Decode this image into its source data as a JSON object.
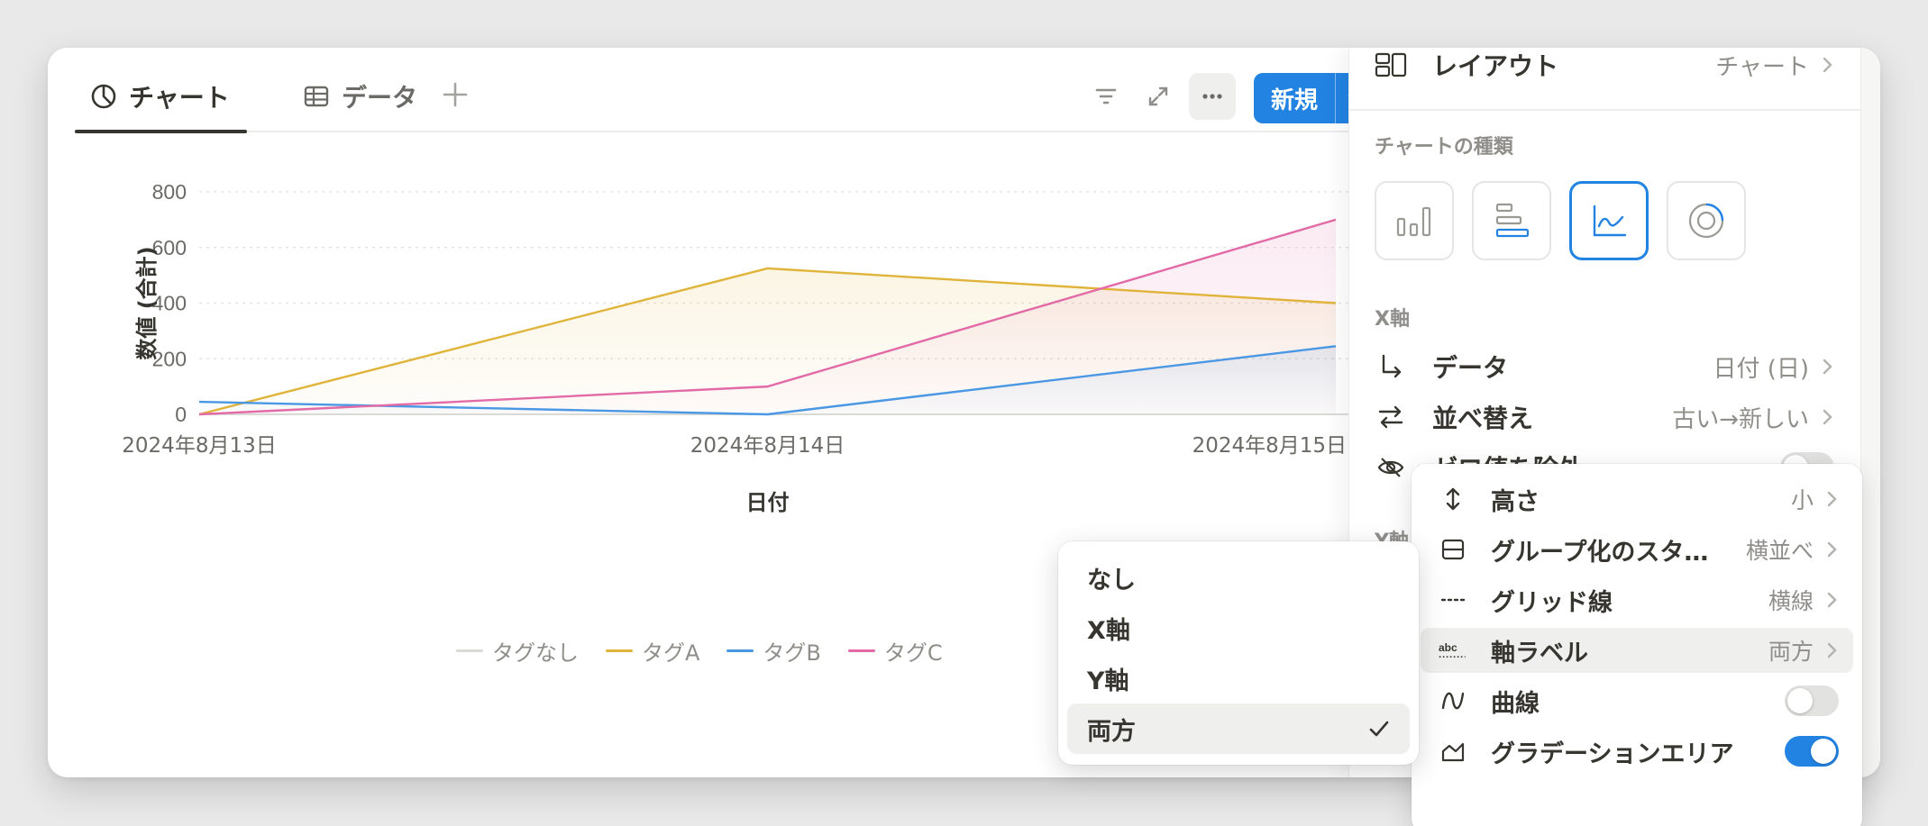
{
  "tabs": [
    {
      "label": "チャート",
      "icon": "chart-icon",
      "active": true
    },
    {
      "label": "データ",
      "icon": "table-icon",
      "active": false
    }
  ],
  "toolbar": {
    "new_label": "新規",
    "icons": [
      "filter-icon",
      "expand-icon",
      "more-icon",
      "chevron-down-icon",
      "plus-icon"
    ]
  },
  "colors": {
    "accent": "#2383e2",
    "none": "#d9d9d6",
    "tagA": "#e0b43a",
    "tagB": "#4a97e4",
    "tagC": "#e26aa6"
  },
  "chart_data": {
    "type": "area",
    "x": [
      "2024年8月13日",
      "2024年8月14日",
      "2024年8月15日"
    ],
    "xlabel": "日付",
    "ylabel": "数値 (合計)",
    "ylim": [
      0,
      800
    ],
    "yticks": [
      0,
      200,
      400,
      600,
      800
    ],
    "grid": "horizontal",
    "legend_position": "bottom",
    "series": [
      {
        "name": "タグなし",
        "values": [
          0,
          0,
          0
        ]
      },
      {
        "name": "タグA",
        "values": [
          0,
          525,
          400
        ]
      },
      {
        "name": "タグB",
        "values": [
          45,
          0,
          245
        ]
      },
      {
        "name": "タグC",
        "values": [
          0,
          100,
          700
        ]
      }
    ]
  },
  "panel": {
    "layout": {
      "label": "レイアウト",
      "value": "チャート"
    },
    "chart_type_label": "チャートの種類",
    "chart_types": [
      "vertical-bar-chart-icon",
      "horizontal-bar-chart-icon",
      "line-chart-icon",
      "donut-chart-icon"
    ],
    "selected_chart_type": "line-chart-icon",
    "x_axis_label": "X軸",
    "x_rows": [
      {
        "label": "データ",
        "value": "日付 (日)"
      },
      {
        "label": "並べ替え",
        "value": "古い→新しい"
      }
    ],
    "hide_zero_label": "ゼロ値を除外",
    "y_axis_label": "Y軸"
  },
  "options_menu": [
    {
      "label": "高さ",
      "value": "小",
      "icon": "height-icon"
    },
    {
      "label": "グループ化のスタ…",
      "value": "横並べ",
      "icon": "group-style-icon"
    },
    {
      "label": "グリッド線",
      "value": "横線",
      "icon": "grid-lines-icon"
    },
    {
      "label": "軸ラベル",
      "value": "両方",
      "icon": "axis-label-icon"
    },
    {
      "label": "曲線",
      "value": "off",
      "icon": "curve-icon"
    },
    {
      "label": "グラデーションエリア",
      "value": "on",
      "icon": "gradient-area-icon"
    }
  ],
  "axis_label_options": [
    "なし",
    "X軸",
    "Y軸",
    "両方"
  ],
  "axis_label_selected": "両方"
}
